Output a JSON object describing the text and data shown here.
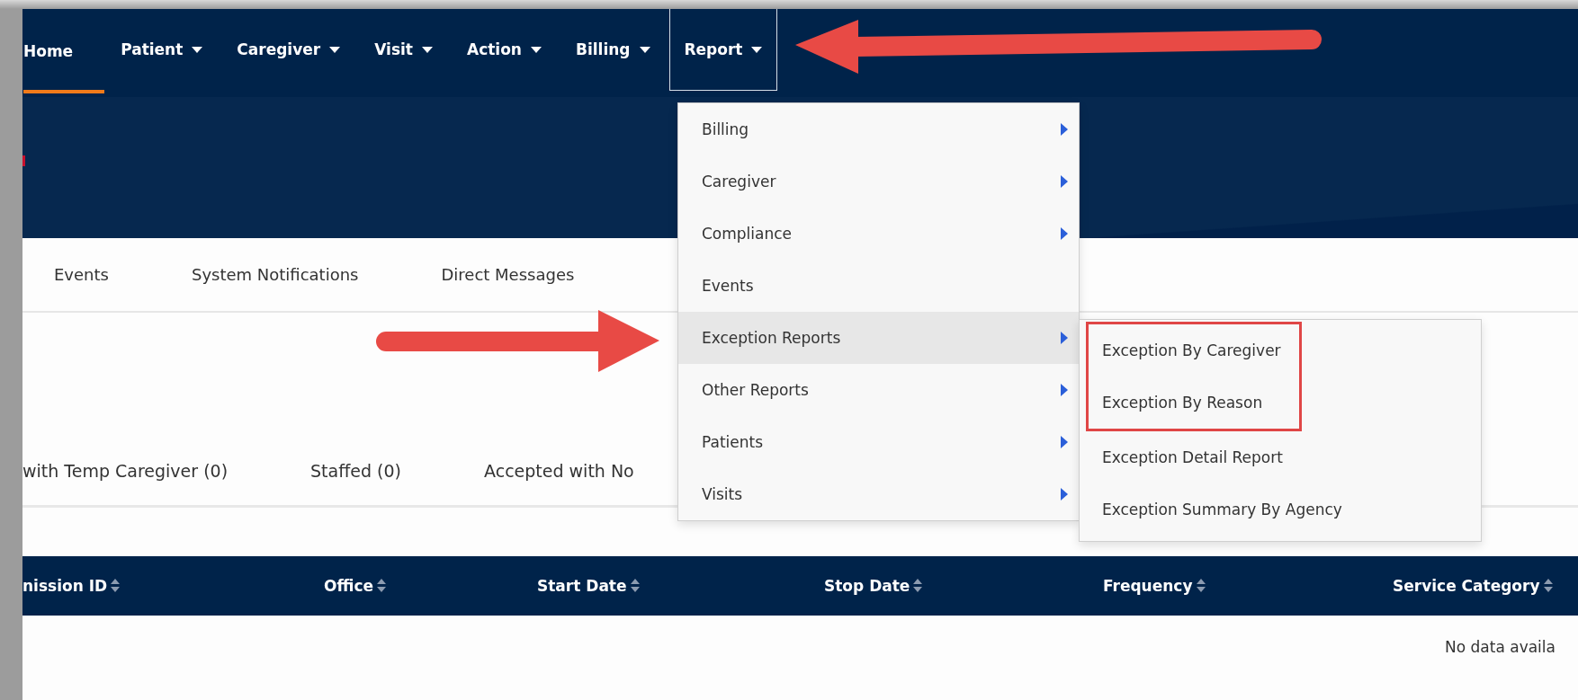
{
  "nav": {
    "items": [
      {
        "label": "Home",
        "dropdown": false,
        "active": true,
        "open": false
      },
      {
        "label": "Patient",
        "dropdown": true,
        "active": false,
        "open": false
      },
      {
        "label": "Caregiver",
        "dropdown": true,
        "active": false,
        "open": false
      },
      {
        "label": "Visit",
        "dropdown": true,
        "active": false,
        "open": false
      },
      {
        "label": "Action",
        "dropdown": true,
        "active": false,
        "open": false
      },
      {
        "label": "Billing",
        "dropdown": true,
        "active": false,
        "open": false
      },
      {
        "label": "Report",
        "dropdown": true,
        "active": false,
        "open": true
      }
    ]
  },
  "tabs": [
    {
      "label": "Events"
    },
    {
      "label": "System Notifications"
    },
    {
      "label": "Direct Messages"
    }
  ],
  "filters": [
    {
      "label": "with Temp Caregiver (0)"
    },
    {
      "label": "Staffed (0)"
    },
    {
      "label": "Accepted with No"
    }
  ],
  "table": {
    "columns": [
      {
        "label": "nission ID"
      },
      {
        "label": "Office"
      },
      {
        "label": "Start Date"
      },
      {
        "label": "Stop Date"
      },
      {
        "label": "Frequency"
      },
      {
        "label": "Service Category"
      }
    ],
    "empty_message": "No data availa"
  },
  "menu": {
    "items": [
      {
        "label": "Billing",
        "has_submenu": true,
        "selected": false
      },
      {
        "label": "Caregiver",
        "has_submenu": true,
        "selected": false
      },
      {
        "label": "Compliance",
        "has_submenu": true,
        "selected": false
      },
      {
        "label": "Events",
        "has_submenu": false,
        "selected": false
      },
      {
        "label": "Exception Reports",
        "has_submenu": true,
        "selected": true
      },
      {
        "label": "Other Reports",
        "has_submenu": true,
        "selected": false
      },
      {
        "label": "Patients",
        "has_submenu": true,
        "selected": false
      },
      {
        "label": "Visits",
        "has_submenu": true,
        "selected": false
      }
    ]
  },
  "submenu": {
    "items": [
      {
        "label": "Exception By Caregiver",
        "highlighted": true
      },
      {
        "label": "Exception By Reason",
        "highlighted": true
      },
      {
        "label": "Exception Detail Report",
        "highlighted": false
      },
      {
        "label": "Exception Summary By Agency",
        "highlighted": false
      }
    ]
  }
}
